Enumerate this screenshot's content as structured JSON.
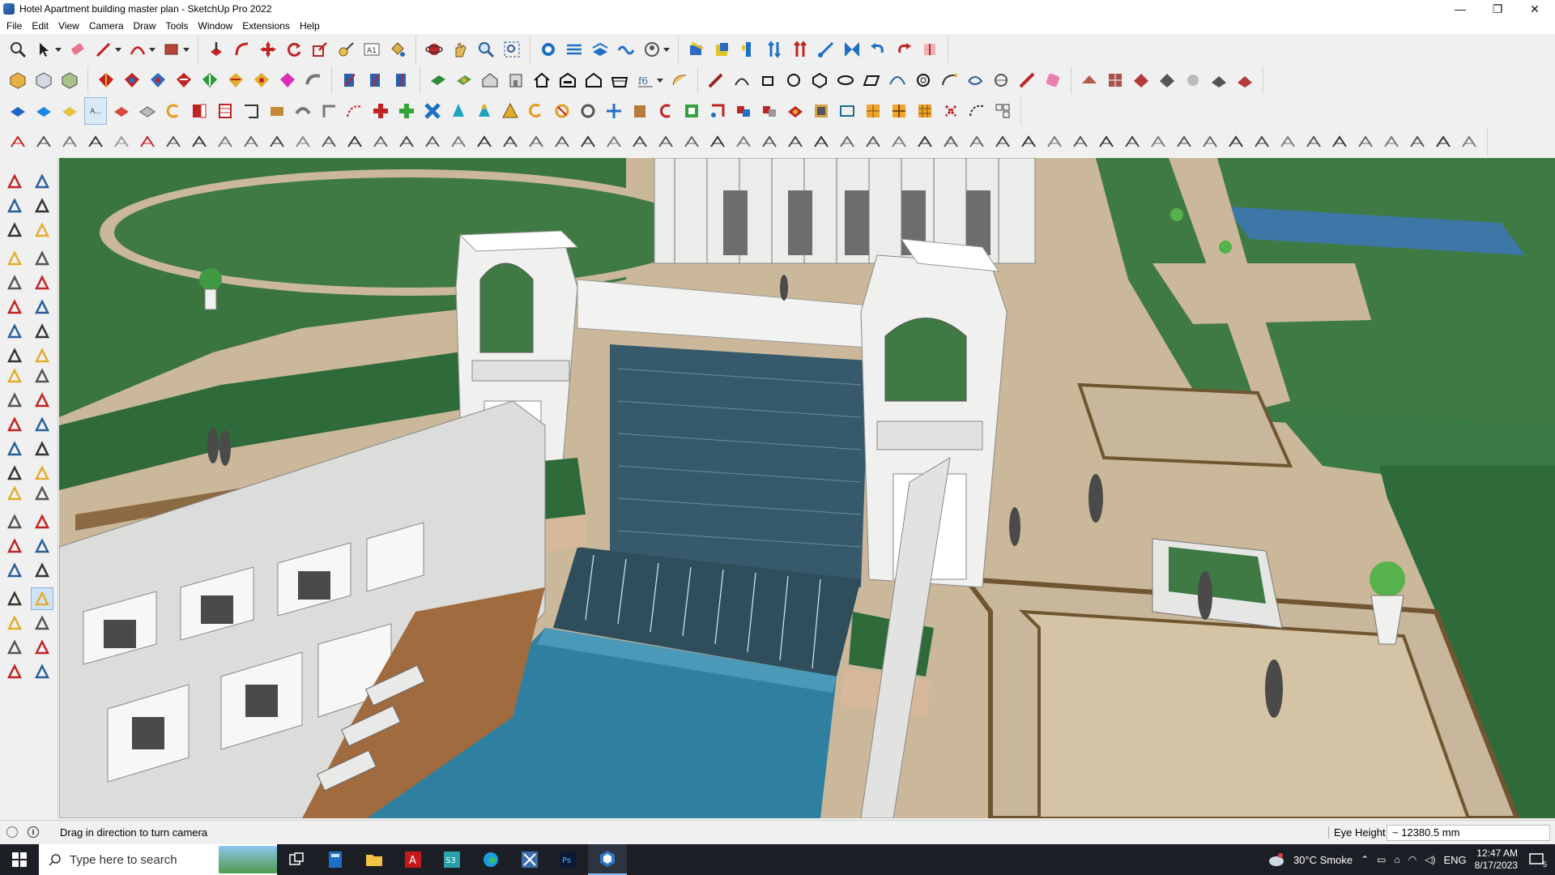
{
  "window": {
    "title": "Hotel Apartment building master plan - SketchUp Pro 2022",
    "controls": {
      "minimize": "—",
      "restore": "❐",
      "close": "✕"
    }
  },
  "menu": [
    "File",
    "Edit",
    "View",
    "Camera",
    "Draw",
    "Tools",
    "Window",
    "Extensions",
    "Help"
  ],
  "floating_tool": {
    "label": "A..."
  },
  "status": {
    "hint": "Drag in direction to turn camera",
    "measure_label": "Eye Height",
    "measure_value": "~ 12380.5 mm"
  },
  "taskbar": {
    "search_placeholder": "Type here to search",
    "weather": "30°C  Smoke",
    "language": "ENG",
    "time": "12:47 AM",
    "date": "8/17/2023",
    "notification_count": "5"
  },
  "colors": {
    "grass": "#3f7a45",
    "pool": "#2f7fa0",
    "paving": "#cbb89a",
    "stone": "#e8e8e6",
    "accent_blue": "#1d6fd1"
  }
}
